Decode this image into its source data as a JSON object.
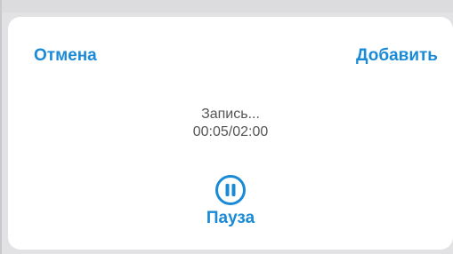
{
  "dialog": {
    "cancel_label": "Отмена",
    "add_label": "Добавить",
    "status_text": "Запись...",
    "timer_text": "00:05/02:00",
    "pause_label": "Пауза",
    "pause_icon": "pause-circle-icon"
  },
  "colors": {
    "accent": "#1a8ad6",
    "status_text": "#555558",
    "sheet_background": "#ffffff",
    "backdrop": "#e2e2e4"
  }
}
